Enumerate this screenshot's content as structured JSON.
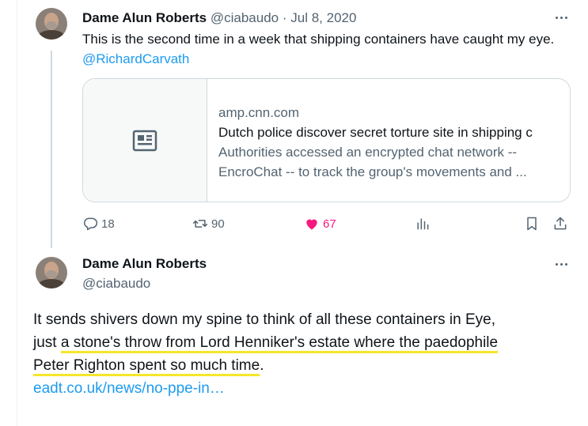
{
  "tweet1": {
    "name": "Dame Alun Roberts",
    "handle": "@ciabaudo",
    "separator": "·",
    "date": "Jul 8, 2020",
    "text": "This is the second time in a week that shipping containers have caught my eye.",
    "mention": "@RichardCarvath",
    "card": {
      "domain": "amp.cnn.com",
      "title": "Dutch police discover secret torture site in shipping c",
      "desc_line1": "Authorities accessed an encrypted chat network --",
      "desc_line2": "EncroChat -- to track the group's movements and ..."
    },
    "actions": {
      "replies": "18",
      "retweets": "90",
      "likes": "67"
    }
  },
  "tweet2": {
    "name": "Dame Alun Roberts",
    "handle": "@ciabaudo",
    "text_part1": "It sends shivers down my spine to think of all these containers in Eye,",
    "text_part2": "just ",
    "text_highlight1": "a stone's throw from Lord Henniker's estate where the paedophile",
    "text_highlight2": "Peter Righton spent so much time",
    "text_period": ".",
    "link": "eadt.co.uk/news/no-ppe-in…"
  },
  "icons": {
    "reply": "reply-icon",
    "retweet": "retweet-icon",
    "like": "heart-icon",
    "views": "views-icon",
    "bookmark": "bookmark-icon",
    "share": "share-icon",
    "more": "more-icon",
    "card_placeholder": "article-icon"
  },
  "colors": {
    "link": "#1d9bf0",
    "like": "#f91880",
    "muted": "#536471",
    "highlight": "#f5e62a"
  }
}
